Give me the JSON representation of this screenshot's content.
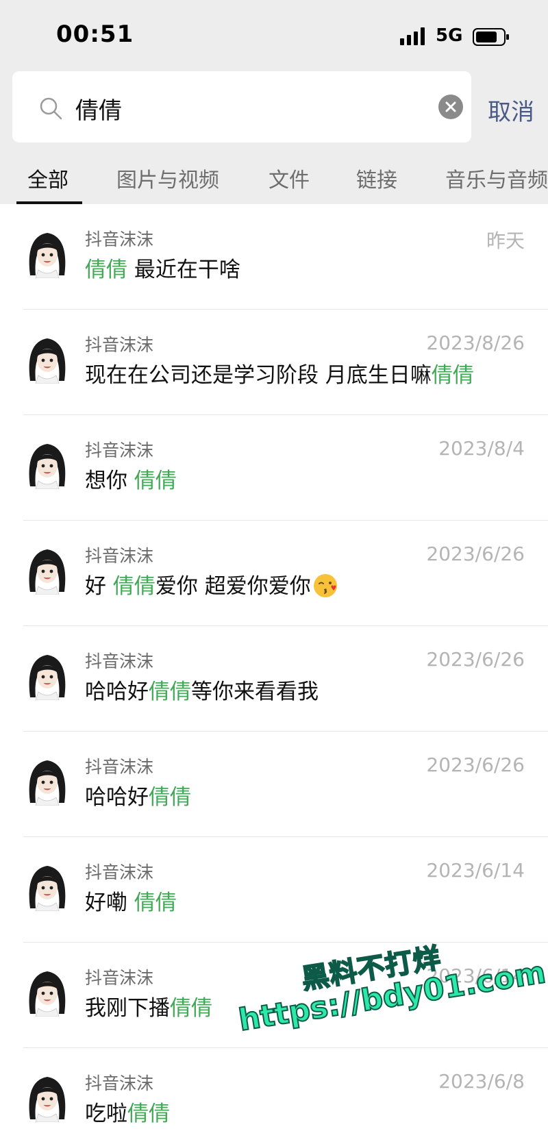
{
  "status": {
    "time": "00:51",
    "network": "5G"
  },
  "search": {
    "query": "倩倩",
    "cancel_label": "取消"
  },
  "tabs": [
    {
      "label": "全部",
      "active": true
    },
    {
      "label": "图片与视频",
      "active": false
    },
    {
      "label": "文件",
      "active": false
    },
    {
      "label": "链接",
      "active": false
    },
    {
      "label": "音乐与音频",
      "active": false
    }
  ],
  "results": [
    {
      "name": "抖音沫沫",
      "date": "昨天",
      "before": "",
      "highlight": "倩倩",
      "after": " 最近在干啥"
    },
    {
      "name": "抖音沫沫",
      "date": "2023/8/26",
      "before": "现在在公司还是学习阶段 月底生日嘛",
      "highlight": "倩倩",
      "after": ""
    },
    {
      "name": "抖音沫沫",
      "date": "2023/8/4",
      "before": "想你 ",
      "highlight": "倩倩",
      "after": ""
    },
    {
      "name": "抖音沫沫",
      "date": "2023/6/26",
      "before": "好 ",
      "highlight": "倩倩",
      "after": "爱你 超爱你爱你"
    },
    {
      "name": "抖音沫沫",
      "date": "2023/6/26",
      "before": "哈哈好",
      "highlight": "倩倩",
      "after": "等你来看看我"
    },
    {
      "name": "抖音沫沫",
      "date": "2023/6/26",
      "before": "哈哈好",
      "highlight": "倩倩",
      "after": ""
    },
    {
      "name": "抖音沫沫",
      "date": "2023/6/14",
      "before": "好嘞 ",
      "highlight": "倩倩",
      "after": ""
    },
    {
      "name": "抖音沫沫",
      "date": "2023/6/14",
      "before": "我刚下播",
      "highlight": "倩倩",
      "after": ""
    },
    {
      "name": "抖音沫沫",
      "date": "2023/6/8",
      "before": "吃啦",
      "highlight": "倩倩",
      "after": ""
    }
  ],
  "watermark": {
    "line1": "黑料不打烊",
    "line2": "https://bdy01.com"
  },
  "colors": {
    "highlight": "#43a856",
    "cancel": "#4a5a86",
    "background_top": "#ededed"
  }
}
